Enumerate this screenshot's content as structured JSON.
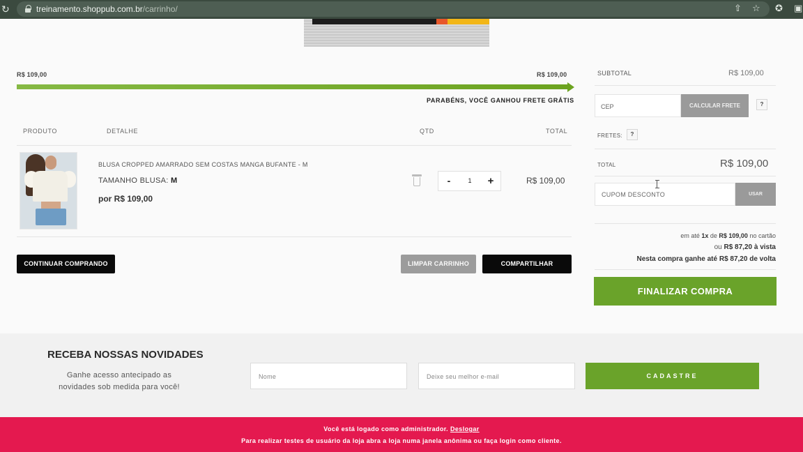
{
  "browser": {
    "url_host": "treinamento.shoppub.com.br",
    "url_path": "/carrinho/"
  },
  "progress": {
    "left_value": "R$ 109,00",
    "right_value": "R$ 109,00",
    "percent": 100,
    "message": "PARABÉNS, VOCÊ GANHOU FRETE GRÁTIS",
    "color": "#6ca31f"
  },
  "cart": {
    "headers": {
      "product": "PRODUTO",
      "detail": "DETALHE",
      "qty": "QTD",
      "total": "TOTAL"
    },
    "items": [
      {
        "name": "BLUSA CROPPED AMARRADO SEM COSTAS MANGA BUFANTE - M",
        "variant_label": "TAMANHO BLUSA:",
        "variant_value": "M",
        "unit_price": "por R$ 109,00",
        "quantity": "1",
        "total": "R$ 109,00"
      }
    ],
    "qty_minus": "-",
    "qty_plus": "+"
  },
  "actions": {
    "continue": "CONTINUAR COMPRANDO",
    "clear": "LIMPAR CARRINHO",
    "share": "COMPARTILHAR"
  },
  "summary": {
    "subtotal_label": "SUBTOTAL",
    "subtotal_value": "R$ 109,00",
    "cep_placeholder": "CEP",
    "calc_shipping": "CALCULAR FRETE",
    "help": "?",
    "shipping_label": "FRETES:",
    "total_label": "TOTAL",
    "total_value": "R$ 109,00",
    "coupon_placeholder": "CUPOM DESCONTO",
    "coupon_button": "USAR",
    "installments_prefix": "em até",
    "installments_count": "1x",
    "installments_de": "de",
    "installments_value": "R$ 109,00",
    "installments_suffix": "no cartão",
    "cash_prefix": "ou",
    "cash_value": "R$ 87,20 à vista",
    "cashback": "Nesta compra ganhe até R$ 87,20 de volta",
    "checkout": "FINALIZAR COMPRA",
    "accent": "#6aa32a"
  },
  "newsletter": {
    "title": "RECEBA NOSSAS NOVIDADES",
    "subtitle": "Ganhe acesso antecipado as novidades sob medida para você!",
    "name_placeholder": "Nome",
    "email_placeholder": "Deixe seu melhor e-mail",
    "submit": "CADASTRE"
  },
  "admin_bar": {
    "line1": "Você está logado como administrador.",
    "logout": "Deslogar",
    "line2": "Para realizar testes de usuário da loja abra a loja numa janela anônima ou faça login como cliente.",
    "color": "#e4194f"
  }
}
